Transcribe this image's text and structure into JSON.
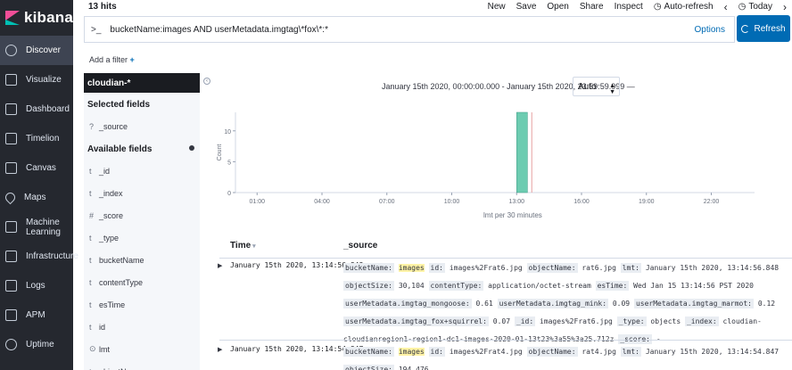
{
  "app": {
    "name": "kibana"
  },
  "sidebar": {
    "items": [
      {
        "label": "Discover",
        "icon": "compass-icon",
        "active": true
      },
      {
        "label": "Visualize",
        "icon": "visualize-icon"
      },
      {
        "label": "Dashboard",
        "icon": "dashboard-icon"
      },
      {
        "label": "Timelion",
        "icon": "timelion-icon"
      },
      {
        "label": "Canvas",
        "icon": "canvas-icon"
      },
      {
        "label": "Maps",
        "icon": "maps-icon"
      },
      {
        "label": "Machine Learning",
        "icon": "machine-learning-icon"
      },
      {
        "label": "Infrastructure",
        "icon": "infrastructure-icon"
      },
      {
        "label": "Logs",
        "icon": "logs-icon"
      },
      {
        "label": "APM",
        "icon": "apm-icon"
      },
      {
        "label": "Uptime",
        "icon": "uptime-icon"
      }
    ]
  },
  "topbar": {
    "hits": "13 hits",
    "menu": {
      "new": "New",
      "save": "Save",
      "open": "Open",
      "share": "Share",
      "inspect": "Inspect",
      "auto_refresh": "Auto-refresh",
      "today": "Today"
    }
  },
  "query": {
    "prompt": ">_",
    "text": "bucketName:images  AND userMetadata.imgtag\\*fox\\*:*",
    "options": "Options",
    "refresh": "Refresh"
  },
  "filters": {
    "add_filter": "Add a filter",
    "plus": "+"
  },
  "fields_panel": {
    "index_pattern": "cloudian-*",
    "selected_header": "Selected fields",
    "selected": [
      {
        "type": "?",
        "name": "_source"
      }
    ],
    "available_header": "Available fields",
    "available": [
      {
        "type": "t",
        "name": "_id"
      },
      {
        "type": "t",
        "name": "_index"
      },
      {
        "type": "#",
        "name": "_score"
      },
      {
        "type": "t",
        "name": "_type"
      },
      {
        "type": "t",
        "name": "bucketName"
      },
      {
        "type": "t",
        "name": "contentType"
      },
      {
        "type": "t",
        "name": "esTime"
      },
      {
        "type": "t",
        "name": "id"
      },
      {
        "type": "⊙",
        "name": "lmt"
      },
      {
        "type": "t",
        "name": "objectName"
      }
    ]
  },
  "histogram": {
    "time_range": "January 15th 2020, 00:00:00.000 - January 15th 2020, 23:59:59.999 —",
    "interval": "Auto",
    "xlabel": "lmt per 30 minutes",
    "ylabel": "Count"
  },
  "chart_data": {
    "type": "bar",
    "x_ticks": [
      "01:00",
      "04:00",
      "07:00",
      "10:00",
      "13:00",
      "16:00",
      "19:00",
      "22:00"
    ],
    "y_ticks": [
      0,
      5,
      10
    ],
    "ylim": [
      0,
      13
    ],
    "xlabel": "lmt per 30 minutes",
    "ylabel": "Count",
    "bars": [
      {
        "start_hour": 13.0,
        "end_hour": 13.5,
        "value": 13
      }
    ],
    "current_time_marker_hour": 13.7,
    "bar_color": "#6dccb1"
  },
  "documents": {
    "time_header": "Time",
    "source_header": "_source",
    "rows": [
      {
        "time": "January 15th 2020, 13:14:56.848",
        "fields": [
          {
            "k": "bucketName:",
            "v": "images",
            "hl": true
          },
          {
            "k": "id:",
            "v": "images%2Frat6.jpg"
          },
          {
            "k": "objectName:",
            "v": "rat6.jpg"
          },
          {
            "k": "lmt:",
            "v": "January 15th 2020, 13:14:56.848"
          },
          {
            "k": "objectSize:",
            "v": "30,104"
          },
          {
            "k": "contentType:",
            "v": "application/octet-stream"
          },
          {
            "k": "esTime:",
            "v": "Wed Jan 15 13:14:56 PST 2020"
          },
          {
            "k": "userMetadata.imgtag_mongoose:",
            "v": "0.61"
          },
          {
            "k": "userMetadata.imgtag_mink:",
            "v": "0.09"
          },
          {
            "k": "userMetadata.imgtag_marmot:",
            "v": "0.12"
          },
          {
            "k": "userMetadata.imgtag_fox+squirrel:",
            "v": "0.07"
          },
          {
            "k": "_id:",
            "v": "images%2Frat6.jpg"
          },
          {
            "k": "_type:",
            "v": "objects"
          },
          {
            "k": "_index:",
            "v": "cloudian-cloudianregion1-region1-dc1-images-2020-01-13t23%3a55%3a25.712z"
          },
          {
            "k": "_score:",
            "v": "-"
          }
        ]
      },
      {
        "time": "January 15th 2020, 13:14:54.847",
        "fields": [
          {
            "k": "bucketName:",
            "v": "images",
            "hl": true
          },
          {
            "k": "id:",
            "v": "images%2Frat4.jpg"
          },
          {
            "k": "objectName:",
            "v": "rat4.jpg"
          },
          {
            "k": "lmt:",
            "v": "January 15th 2020, 13:14:54.847"
          },
          {
            "k": "objectSize:",
            "v": "194,476"
          }
        ]
      }
    ]
  }
}
